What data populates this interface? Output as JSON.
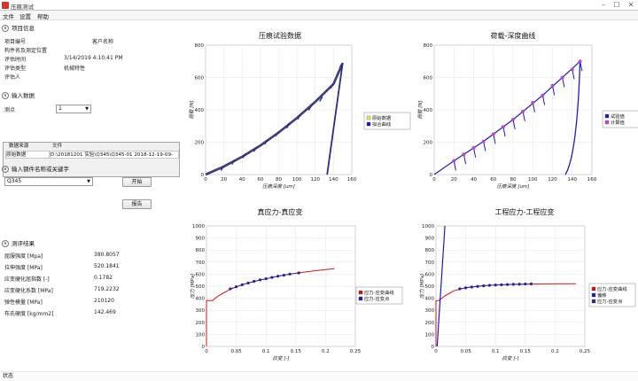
{
  "window": {
    "title": "压痕测试"
  },
  "menu": {
    "file": "文件",
    "settings": "设置",
    "help": "帮助"
  },
  "project": {
    "header": "项目信息",
    "rows": [
      {
        "label": "项目编号",
        "value": "客户名称"
      },
      {
        "label": "构件名及测定位置",
        "value": ""
      },
      {
        "label": "评估时间",
        "value": "3/14/2019 4:10:41 PM"
      },
      {
        "label": "评估类型",
        "value": "机械特性"
      },
      {
        "label": "评估人",
        "value": ""
      }
    ]
  },
  "input": {
    "header": "输入数据",
    "point_label": "测点",
    "point_value": "1",
    "grid_headers": [
      "数据来源",
      "文件"
    ],
    "grid_row": [
      "原始数据",
      "D:\\20181201 实验\\Q345\\Q345-01 2018-12-19-09-"
    ]
  },
  "material": {
    "header": "输入钢件名称或关键字",
    "value": "Q345",
    "start_button": "开始",
    "report_button": "报告"
  },
  "results": {
    "header": "测评结果",
    "rows": [
      {
        "label": "屈服强度 [Mpa]",
        "value": "380.8057"
      },
      {
        "label": "拉伸强度 [MPa]",
        "value": "520.1841"
      },
      {
        "label": "应变硬化屈指数 [-]",
        "value": "0.1782"
      },
      {
        "label": "应变硬化系数 [MPa]",
        "value": "719.2232"
      },
      {
        "label": "弹性模量 [MPa]",
        "value": "210120"
      },
      {
        "label": "布氏硬度 [kg/mm2]",
        "value": "142.469"
      }
    ]
  },
  "status": "状态",
  "colors": {
    "navy": "#2b2b8a",
    "blue": "#1a1acc",
    "red": "#dd1111",
    "magenta": "#cc44cc",
    "olive": "#8b8b30",
    "legend_yellow": "#e8e860"
  },
  "chart_data": [
    {
      "type": "line",
      "title": "压痕试验数据",
      "xlabel": "压痕深度 [um]",
      "ylabel": "荷载 [N]",
      "xlim": [
        0,
        160
      ],
      "ylim": [
        0,
        800
      ],
      "xticks": [
        0,
        20,
        40,
        60,
        80,
        100,
        120,
        140,
        160
      ],
      "yticks": [
        0,
        200,
        400,
        600,
        800
      ],
      "series": [
        {
          "name": "原始数据",
          "loading": [
            [
              0,
              0
            ],
            [
              20,
              50
            ],
            [
              40,
              110
            ],
            [
              60,
              180
            ],
            [
              80,
              260
            ],
            [
              100,
              350
            ],
            [
              120,
              450
            ],
            [
              140,
              560
            ],
            [
              150,
              690
            ]
          ],
          "unload_start": [
            [
              20,
              52
            ],
            [
              32,
              90
            ],
            [
              44,
              130
            ],
            [
              56,
              170
            ],
            [
              68,
              215
            ],
            [
              80,
              265
            ],
            [
              92,
              315
            ],
            [
              104,
              370
            ],
            [
              116,
              425
            ],
            [
              128,
              480
            ],
            [
              140,
              560
            ],
            [
              150,
              690
            ]
          ],
          "unload_drop": 20
        },
        {
          "name": "拟合曲线"
        }
      ],
      "final_unload": [
        [
          150,
          690
        ],
        [
          133,
          0
        ]
      ],
      "grid": true
    },
    {
      "type": "line",
      "title": "荷载-深度曲线",
      "xlabel": "压痕深度 [um]",
      "ylabel": "荷载 [N]",
      "xlim": [
        0,
        160
      ],
      "ylim": [
        0,
        800
      ],
      "xticks": [
        0,
        20,
        40,
        60,
        80,
        100,
        120,
        140,
        160
      ],
      "yticks": [
        0,
        200,
        400,
        600,
        800
      ],
      "series": [
        {
          "name": "试验值",
          "points": [
            [
              20,
              85
            ],
            [
              30,
              125
            ],
            [
              40,
              165
            ],
            [
              50,
              205
            ],
            [
              60,
              250
            ],
            [
              70,
              295
            ],
            [
              80,
              340
            ],
            [
              90,
              390
            ],
            [
              100,
              445
            ],
            [
              110,
              490
            ],
            [
              120,
              550
            ],
            [
              130,
              600
            ],
            [
              140,
              650
            ],
            [
              148,
              700
            ]
          ]
        },
        {
          "name": "计算值",
          "points": [
            [
              20,
              85
            ],
            [
              30,
              125
            ],
            [
              40,
              165
            ],
            [
              50,
              205
            ],
            [
              60,
              250
            ],
            [
              70,
              295
            ],
            [
              80,
              340
            ],
            [
              90,
              390
            ],
            [
              100,
              445
            ],
            [
              110,
              490
            ],
            [
              120,
              550
            ],
            [
              130,
              600
            ],
            [
              140,
              650
            ],
            [
              148,
              700
            ]
          ]
        }
      ],
      "curve": [
        [
          0,
          0
        ],
        [
          20,
          85
        ],
        [
          50,
          205
        ],
        [
          80,
          340
        ],
        [
          110,
          490
        ],
        [
          148,
          700
        ]
      ],
      "final_unload": [
        [
          148,
          700
        ],
        [
          133,
          0
        ]
      ],
      "grid": true
    },
    {
      "type": "line",
      "title": "真应力-真应变",
      "xlabel": "应变 [-]",
      "ylabel": "应力 [MPa]",
      "xlim": [
        0,
        0.25
      ],
      "ylim": [
        0,
        1000
      ],
      "xticks": [
        "0",
        "0.05",
        "0.1",
        "0.15",
        "0.2",
        "0.25"
      ],
      "yticks": [
        0,
        100,
        200,
        300,
        400,
        500,
        600,
        700,
        800,
        900,
        1000
      ],
      "series": [
        {
          "name": "应力-应变曲线",
          "points": [
            [
              0,
              0
            ],
            [
              0,
              380
            ],
            [
              0.01,
              381
            ],
            [
              0.02,
              420
            ],
            [
              0.04,
              475
            ],
            [
              0.06,
              512
            ],
            [
              0.08,
              540
            ],
            [
              0.1,
              562
            ],
            [
              0.12,
              583
            ],
            [
              0.14,
              600
            ],
            [
              0.16,
              614
            ],
            [
              0.18,
              627
            ],
            [
              0.2,
              638
            ],
            [
              0.215,
              645
            ]
          ]
        },
        {
          "name": "应力-应变点",
          "points": [
            [
              0.04,
              478
            ],
            [
              0.05,
              495
            ],
            [
              0.06,
              512
            ],
            [
              0.07,
              526
            ],
            [
              0.08,
              540
            ],
            [
              0.09,
              552
            ],
            [
              0.1,
              562
            ],
            [
              0.11,
              573
            ],
            [
              0.12,
              583
            ],
            [
              0.13,
              591
            ],
            [
              0.14,
              600
            ],
            [
              0.155,
              610
            ]
          ]
        }
      ],
      "grid": true
    },
    {
      "type": "line",
      "title": "工程应力-工程应变",
      "xlabel": "应变 [-]",
      "ylabel": "应力 [MPa]",
      "xlim": [
        0,
        0.25
      ],
      "ylim": [
        0,
        1000
      ],
      "xticks": [
        "0",
        "0.05",
        "0.1",
        "0.15",
        "0.2",
        "0.25"
      ],
      "yticks": [
        0,
        100,
        200,
        300,
        400,
        500,
        600,
        700,
        800,
        900,
        1000
      ],
      "series": [
        {
          "name": "应力-应变曲线",
          "points": [
            [
              0,
              0
            ],
            [
              0,
              380
            ],
            [
              0.005,
              381
            ],
            [
              0.015,
              420
            ],
            [
              0.03,
              462
            ],
            [
              0.05,
              488
            ],
            [
              0.07,
              500
            ],
            [
              0.09,
              507
            ],
            [
              0.12,
              513
            ],
            [
              0.15,
              517
            ],
            [
              0.18,
              519
            ],
            [
              0.21,
              520
            ],
            [
              0.235,
              520
            ]
          ]
        },
        {
          "name": "偏移",
          "points": [
            [
              0.002,
              0
            ],
            [
              0.015,
              1000
            ]
          ]
        },
        {
          "name": "应力-应变点",
          "points": [
            [
              0.04,
              478
            ],
            [
              0.05,
              486
            ],
            [
              0.06,
              493
            ],
            [
              0.07,
              498
            ],
            [
              0.08,
              503
            ],
            [
              0.09,
              507
            ],
            [
              0.1,
              510
            ],
            [
              0.11,
              512
            ],
            [
              0.12,
              514
            ],
            [
              0.13,
              516
            ],
            [
              0.14,
              517
            ],
            [
              0.15,
              518
            ],
            [
              0.16,
              519
            ]
          ]
        }
      ],
      "grid": true
    }
  ]
}
